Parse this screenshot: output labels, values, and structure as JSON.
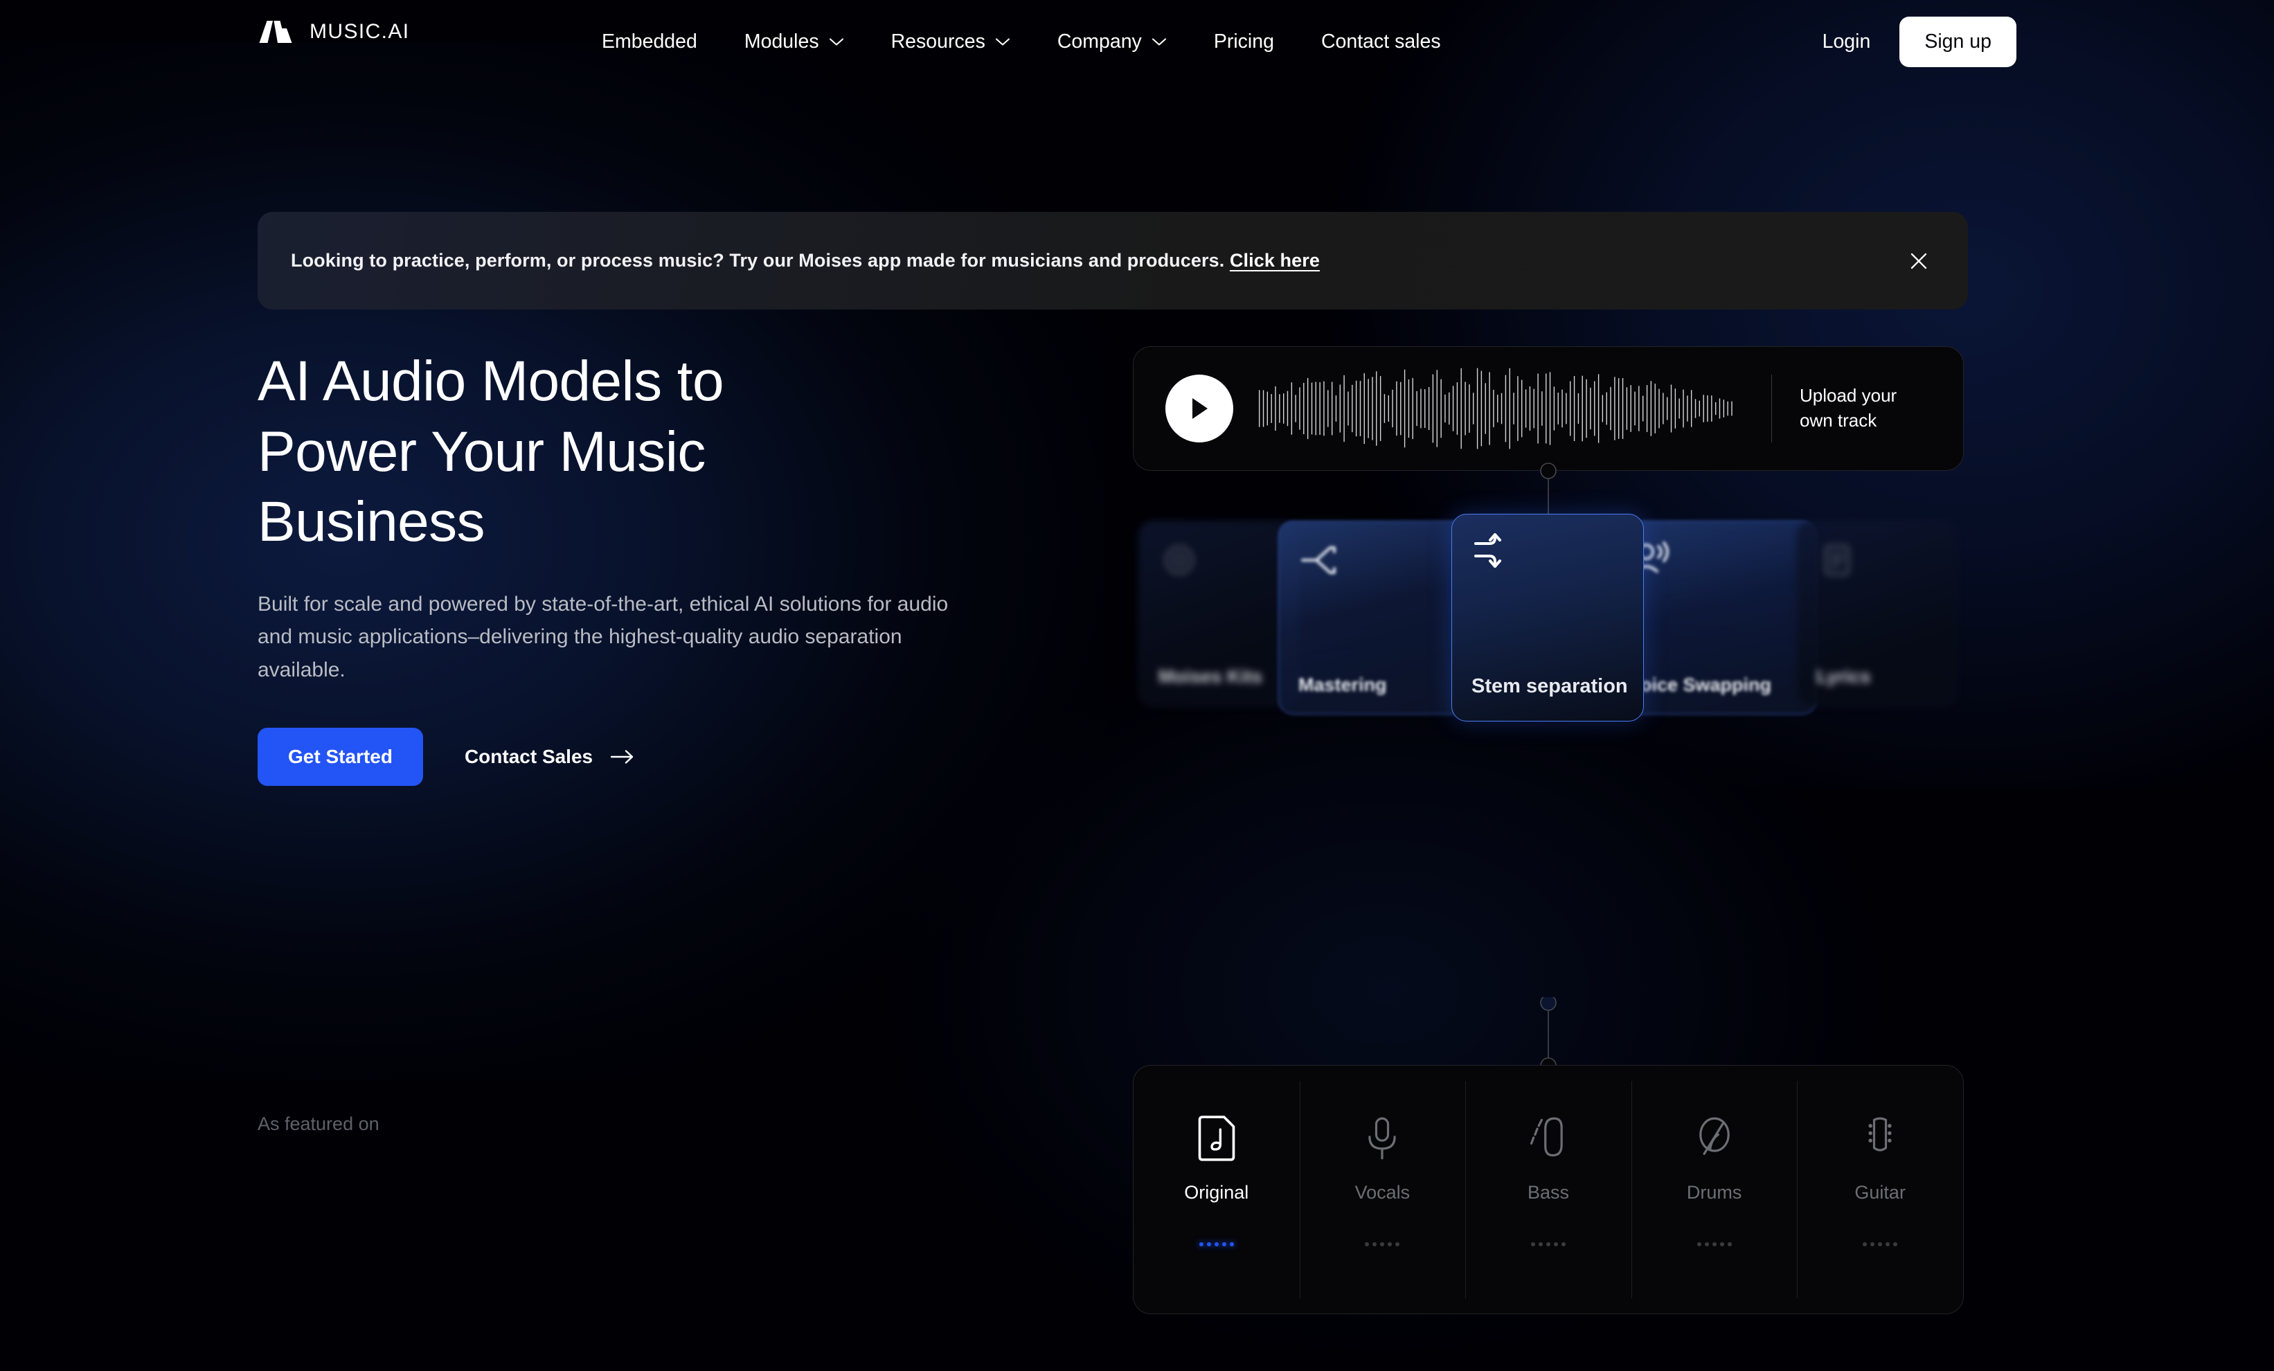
{
  "brand": {
    "name": "MUSIC.AI",
    "logo_icon": "music-ai-logo"
  },
  "nav": {
    "items": [
      {
        "label": "Embedded",
        "has_chevron": false
      },
      {
        "label": "Modules",
        "has_chevron": true
      },
      {
        "label": "Resources",
        "has_chevron": true
      },
      {
        "label": "Company",
        "has_chevron": true
      },
      {
        "label": "Pricing",
        "has_chevron": false
      },
      {
        "label": "Contact sales",
        "has_chevron": false
      }
    ],
    "login_label": "Login",
    "signup_label": "Sign up"
  },
  "banner": {
    "text": "Looking to practice, perform, or process music? Try our Moises app made for musicians and producers. ",
    "link_label": "Click here",
    "close_icon": "close-icon"
  },
  "hero": {
    "title_line1": "AI Audio Models to",
    "title_line2": "Power Your Music",
    "title_line3": "Business",
    "subtitle": "Built for scale and powered by state-of-the-art, ethical AI solutions for audio and music applications–delivering the highest-quality audio separation available.",
    "primary_cta": "Get Started",
    "secondary_cta": "Contact Sales",
    "featured_label": "As featured on"
  },
  "player": {
    "play_icon": "play-icon",
    "upload_label_line1": "Upload your",
    "upload_label_line2": "own track",
    "waveform_icon": "waveform-icon"
  },
  "carousel": {
    "cards": [
      {
        "label": "Moises Kits",
        "icon": "gear-icon",
        "state": "far-left"
      },
      {
        "label": "Mastering",
        "icon": "split-arrows-icon",
        "state": "near-left"
      },
      {
        "label": "Stem separation",
        "icon": "stem-separation-icon",
        "state": "center-selected"
      },
      {
        "label": "Voice Swapping",
        "icon": "voice-swap-icon",
        "state": "near-right"
      },
      {
        "label": "Lyrics",
        "icon": "lyrics-icon",
        "state": "far-right"
      }
    ]
  },
  "stems": {
    "items": [
      {
        "label": "Original",
        "icon": "music-note-file-icon",
        "active": true
      },
      {
        "label": "Vocals",
        "icon": "microphone-icon",
        "active": false
      },
      {
        "label": "Bass",
        "icon": "bass-guitar-icon",
        "active": false
      },
      {
        "label": "Drums",
        "icon": "drums-icon",
        "active": false
      },
      {
        "label": "Guitar",
        "icon": "guitar-icon",
        "active": false
      }
    ]
  },
  "colors": {
    "background": "#000005",
    "accent_blue": "#2354f5",
    "card_border_blue": "#4d7bf3",
    "text_primary": "#ffffff",
    "text_muted": "#b9bcc4",
    "text_dim": "#5f6068",
    "banner_bg": "#1a1d26"
  }
}
